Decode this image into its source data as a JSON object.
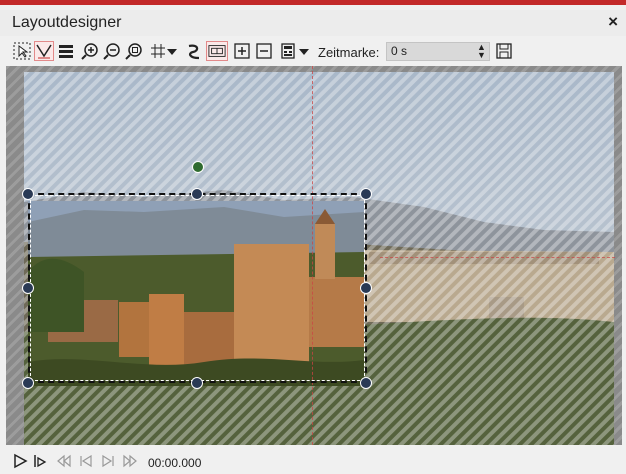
{
  "window": {
    "title": "Layoutdesigner",
    "close_label": "×",
    "accent": "#c32a2a"
  },
  "toolbar": {
    "tools": [
      "select-tool-icon",
      "point-select-icon",
      "layers-icon",
      "zoom-in-icon",
      "zoom-out-icon",
      "zoom-fit-icon",
      "grid-icon",
      "path-icon",
      "frame-icon",
      "add-icon",
      "remove-icon",
      "camera-icon"
    ],
    "zeitmarke_label": "Zeitmarke:",
    "zeitmarke_value": "0 s"
  },
  "playback": {
    "time": "00:00.000"
  }
}
